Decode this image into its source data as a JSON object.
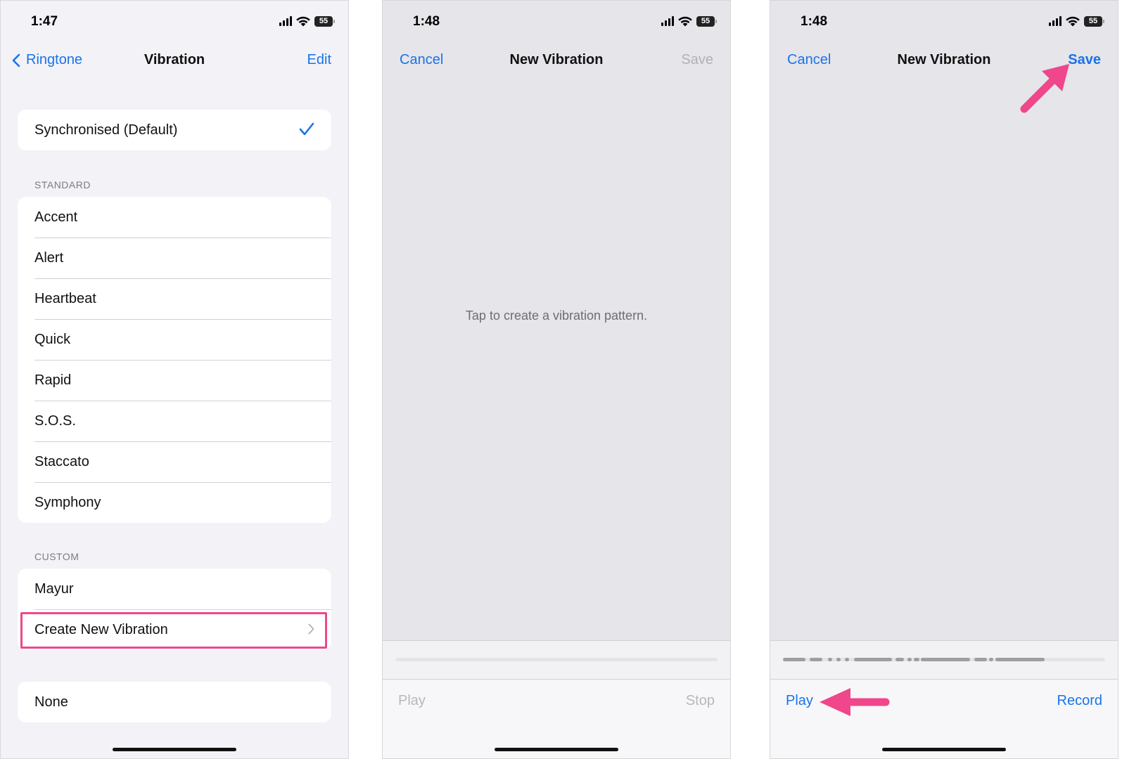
{
  "colors": {
    "ios_blue": "#1a73e8",
    "annotation_pink": "#f0468b",
    "disabled_gray": "#b1b1b6"
  },
  "screen1": {
    "status": {
      "time": "1:47",
      "battery": "55"
    },
    "nav": {
      "back_label": "Ringtone",
      "title": "Vibration",
      "edit_label": "Edit"
    },
    "default_item": {
      "label": "Synchronised (Default)",
      "selected": true
    },
    "standard": {
      "header": "STANDARD",
      "items": [
        "Accent",
        "Alert",
        "Heartbeat",
        "Quick",
        "Rapid",
        "S.O.S.",
        "Staccato",
        "Symphony"
      ]
    },
    "custom": {
      "header": "CUSTOM",
      "items": [
        "Mayur"
      ],
      "create_label": "Create New Vibration"
    },
    "none_label": "None"
  },
  "screen2": {
    "status": {
      "time": "1:48",
      "battery": "55"
    },
    "nav": {
      "cancel_label": "Cancel",
      "title": "New Vibration",
      "save_label": "Save"
    },
    "hint": "Tap to create a vibration pattern.",
    "bottom": {
      "play_label": "Play",
      "stop_label": "Stop"
    }
  },
  "screen3": {
    "status": {
      "time": "1:48",
      "battery": "55"
    },
    "nav": {
      "cancel_label": "Cancel",
      "title": "New Vibration",
      "save_label": "Save"
    },
    "bottom": {
      "play_label": "Play",
      "record_label": "Record"
    }
  }
}
